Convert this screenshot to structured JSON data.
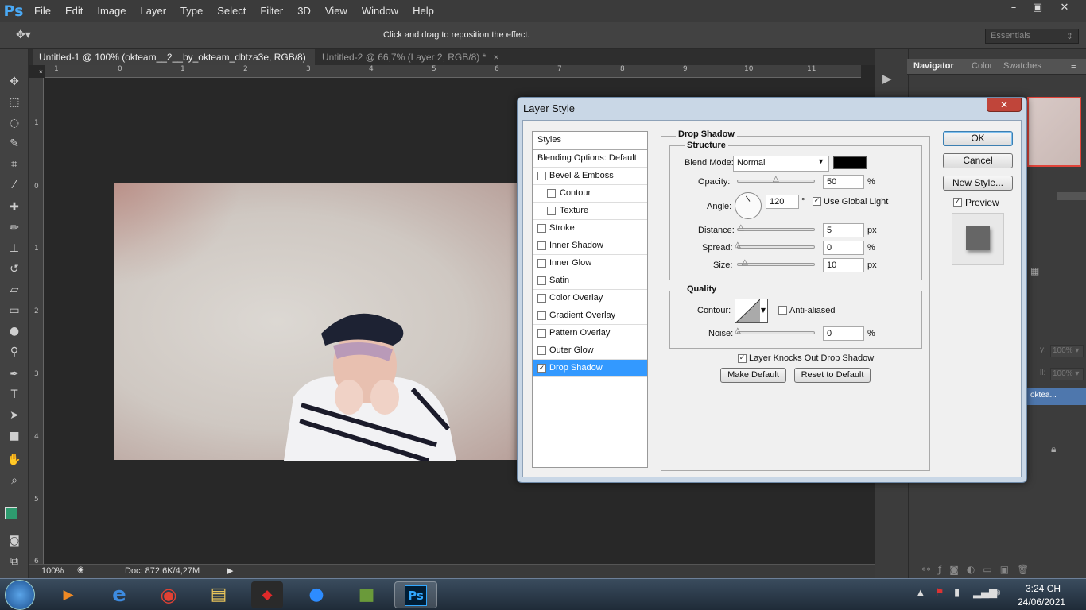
{
  "app": {
    "logo": "Ps",
    "menu": [
      "File",
      "Edit",
      "Image",
      "Layer",
      "Type",
      "Select",
      "Filter",
      "3D",
      "View",
      "Window",
      "Help"
    ],
    "win_controls": [
      "–",
      "▣",
      "✕"
    ]
  },
  "options": {
    "hint": "Click and drag to reposition the effect.",
    "workspace": "Essentials"
  },
  "tabs": [
    {
      "label": "Untitled-1 @ 100% (okteam__2__by_okteam_dbtza3e, RGB/8) *",
      "close": "×"
    },
    {
      "label": "Untitled-2 @ 66,7% (Layer 2, RGB/8) *",
      "close": "×"
    }
  ],
  "ruler": {
    "h": [
      "1",
      "0",
      "1",
      "2",
      "3",
      "4",
      "5",
      "6",
      "7",
      "8",
      "9",
      "10",
      "11"
    ],
    "v": [
      "1",
      "0",
      "1",
      "2",
      "3",
      "4",
      "5",
      "6"
    ]
  },
  "status": {
    "zoom": "100%",
    "doc": "Doc: 872,6K/4,27M"
  },
  "panels": {
    "tabs": [
      "Navigator",
      "Color",
      "Swatches"
    ],
    "opacity": "100%",
    "fill": "100%",
    "layer_name": "okteа...",
    "opacity_label": "y:",
    "fill_label": "ll:"
  },
  "dialog": {
    "title": "Layer Style",
    "close": "✕",
    "styles_header": "Styles",
    "blending": "Blending Options: Default",
    "styles": [
      {
        "label": "Bevel & Emboss",
        "checked": false
      },
      {
        "label": "Contour",
        "checked": false
      },
      {
        "label": "Texture",
        "checked": false
      },
      {
        "label": "Stroke",
        "checked": false
      },
      {
        "label": "Inner Shadow",
        "checked": false
      },
      {
        "label": "Inner Glow",
        "checked": false
      },
      {
        "label": "Satin",
        "checked": false
      },
      {
        "label": "Color Overlay",
        "checked": false
      },
      {
        "label": "Gradient Overlay",
        "checked": false
      },
      {
        "label": "Pattern Overlay",
        "checked": false
      },
      {
        "label": "Outer Glow",
        "checked": false
      },
      {
        "label": "Drop Shadow",
        "checked": true
      }
    ],
    "section": "Drop Shadow",
    "structure": "Structure",
    "blend_mode_label": "Blend Mode:",
    "blend_mode": "Normal",
    "shadow_color": "#000000",
    "opacity_label": "Opacity:",
    "opacity": "50",
    "angle_label": "Angle:",
    "angle": "120",
    "degree": "°",
    "global_light": "Use Global Light",
    "distance_label": "Distance:",
    "distance": "5",
    "spread_label": "Spread:",
    "spread": "0",
    "size_label": "Size:",
    "size": "10",
    "px": "px",
    "pct": "%",
    "quality": "Quality",
    "contour_label": "Contour:",
    "anti_aliased": "Anti-aliased",
    "noise_label": "Noise:",
    "noise": "0",
    "knocks_out": "Layer Knocks Out Drop Shadow",
    "make_default": "Make Default",
    "reset_default": "Reset to Default",
    "ok": "OK",
    "cancel": "Cancel",
    "new_style": "New Style...",
    "preview": "Preview"
  },
  "taskbar": {
    "time": "3:24 CH",
    "date": "24/06/2021",
    "ps_label": "Ps"
  }
}
